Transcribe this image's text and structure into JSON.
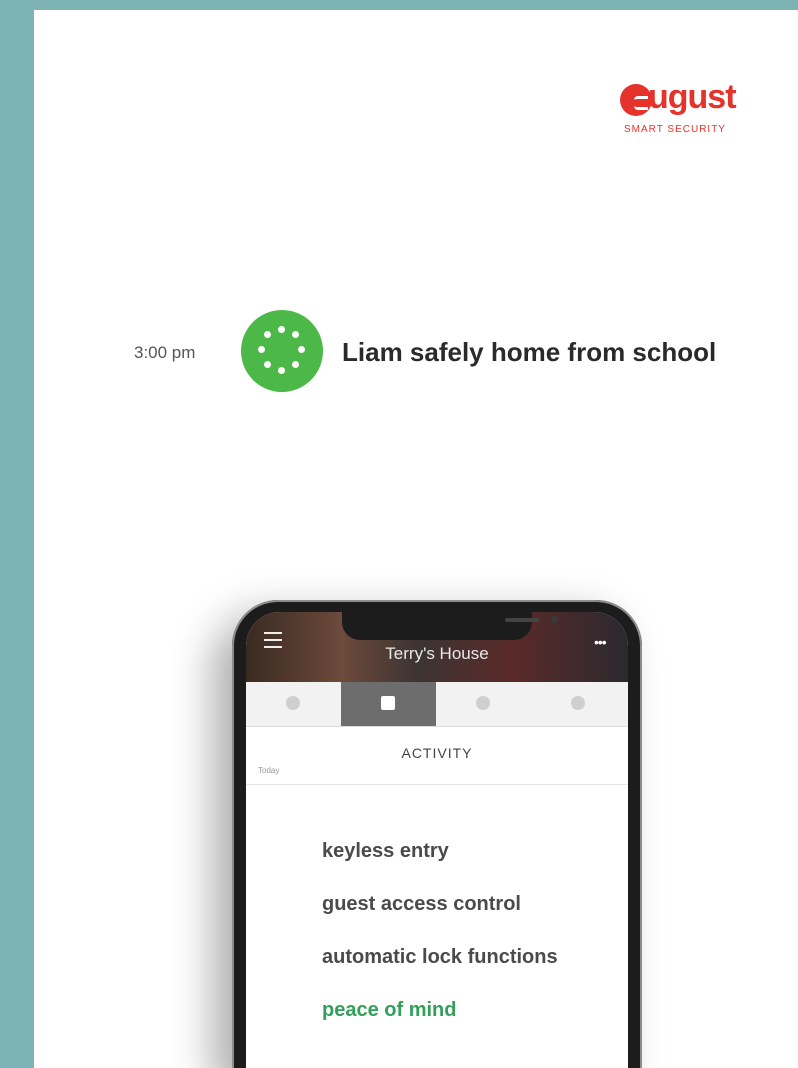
{
  "brand": {
    "name": "ugust",
    "tagline": "SMART SECURITY",
    "color": "#e5322b"
  },
  "notification": {
    "time": "3:00 pm",
    "icon": "status-dots-icon",
    "icon_color": "#4cb848",
    "message": "Liam safely home from school"
  },
  "app": {
    "house_title": "Terry's House",
    "tabs": [
      {
        "icon": "lock-icon",
        "active": false
      },
      {
        "icon": "activity-list-icon",
        "active": true
      },
      {
        "icon": "guests-icon",
        "active": false
      },
      {
        "icon": "settings-gear-icon",
        "active": false
      }
    ],
    "section_title": "ACTIVITY",
    "day_label": "Today"
  },
  "features": [
    {
      "label": "keyless entry",
      "highlight": false
    },
    {
      "label": "guest access control",
      "highlight": false
    },
    {
      "label": "automatic lock functions",
      "highlight": false
    },
    {
      "label": "peace of mind",
      "highlight": true
    }
  ],
  "colors": {
    "background": "#7eb3b5",
    "highlight_text": "#33a05a"
  }
}
